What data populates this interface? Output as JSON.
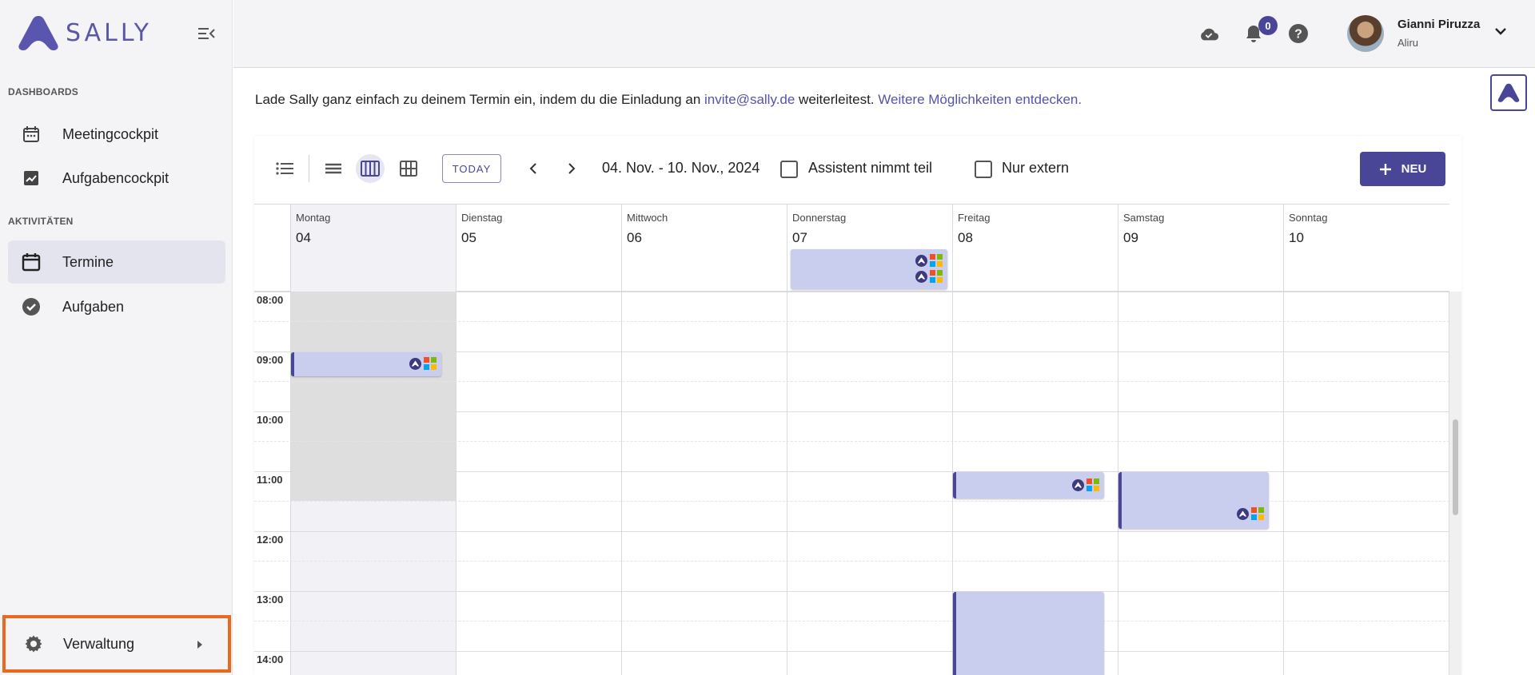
{
  "app": {
    "logo_text": "SALLY"
  },
  "sidebar": {
    "section_dashboards": "DASHBOARDS",
    "section_activities": "AKTIVITÄTEN",
    "items": [
      {
        "label": "Meetingcockpit",
        "icon": "calendar-dots-icon"
      },
      {
        "label": "Aufgabencockpit",
        "icon": "chart-icon"
      },
      {
        "label": "Termine",
        "icon": "calendar-icon",
        "active": true
      },
      {
        "label": "Aufgaben",
        "icon": "check-circle-icon"
      }
    ],
    "admin": {
      "label": "Verwaltung",
      "icon": "gear-icon"
    }
  },
  "topbar": {
    "notification_count": "0",
    "user_name": "Gianni Piruzza",
    "user_org": "Aliru"
  },
  "hint": {
    "text_before": "Lade Sally ganz einfach zu deinem Termin ein, indem du die Einladung an ",
    "email": "invite@sally.de",
    "text_after": " weiterleitest. ",
    "more_link": "Weitere Möglichkeiten entdecken."
  },
  "toolbar": {
    "today_label": "TODAY",
    "date_range": "04. Nov. - 10. Nov., 2024",
    "assistant_label": "Assistent nimmt teil",
    "external_label": "Nur extern",
    "new_label": "NEU"
  },
  "days": [
    {
      "name": "Montag",
      "num": "04"
    },
    {
      "name": "Dienstag",
      "num": "05"
    },
    {
      "name": "Mittwoch",
      "num": "06"
    },
    {
      "name": "Donnerstag",
      "num": "07"
    },
    {
      "name": "Freitag",
      "num": "08"
    },
    {
      "name": "Samstag",
      "num": "09"
    },
    {
      "name": "Sonntag",
      "num": "10"
    }
  ],
  "times": [
    "08:00",
    "09:00",
    "10:00",
    "11:00",
    "12:00",
    "13:00",
    "14:00"
  ],
  "colors": {
    "accent": "#4a4697",
    "event_bg": "#c9cdee",
    "highlight": "#e8691f"
  }
}
